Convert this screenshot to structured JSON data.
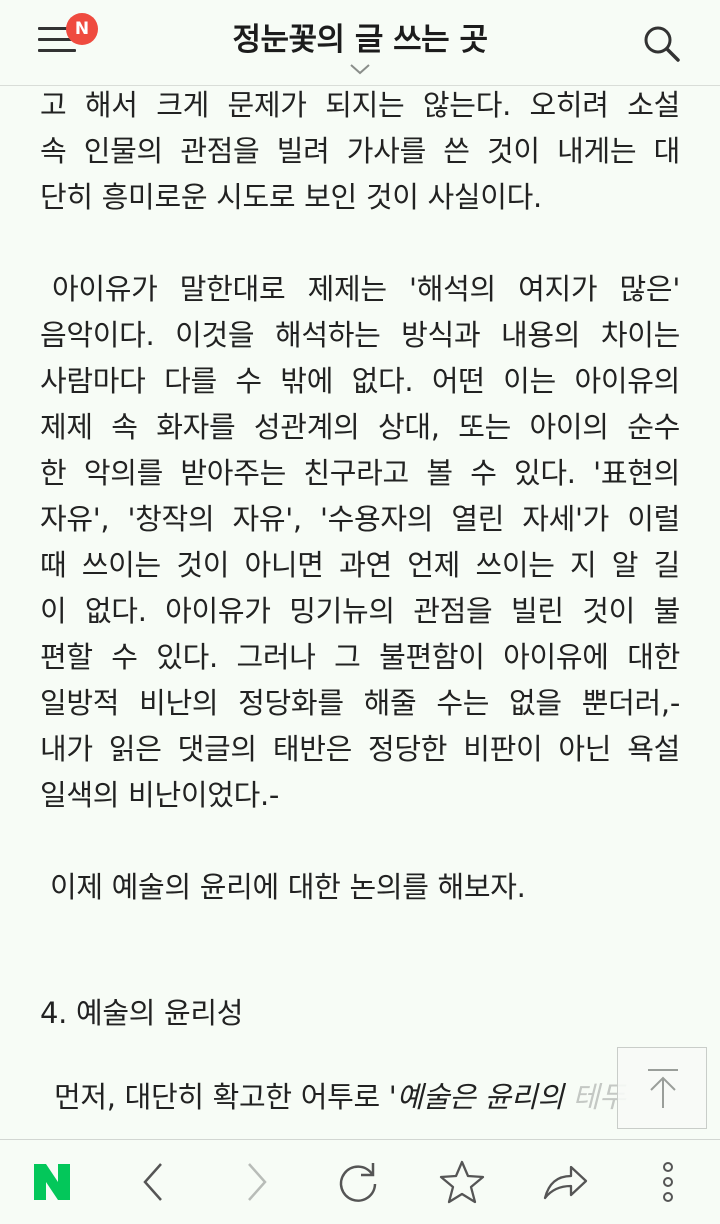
{
  "header": {
    "title": "정눈꽃의 글 쓰는 곳",
    "notification_badge": "N",
    "menu_icon": "hamburger-menu-icon",
    "search_icon": "search-icon",
    "badge_color": "#ef4b3f"
  },
  "article": {
    "lines": [
      "고 해서 크게 문제가 되지는 않는다. 오히려 소설",
      "속 인물의 관점을 빌려 가사를 쓴 것이 내게는 대",
      "단히 흥미로운 시도로 보인 것이 사실이다.",
      "아이유가 말한대로 제제는 '해석의 여지가 많은'",
      "음악이다. 이것을 해석하는 방식과 내용의 차이는",
      "사람마다 다를 수 밖에 없다. 어떤 이는 아이유의",
      "제제 속 화자를 성관계의 상대, 또는 아이의 순수",
      "한 악의를 받아주는 친구라고 볼 수 있다. '표현의",
      "자유', '창작의 자유', '수용자의 열린 자세'가 이럴",
      "때 쓰이는 것이 아니면 과연 언제 쓰이는 지 알 길",
      "이 없다. 아이유가 밍기뉴의 관점을 빌린 것이 불",
      "편할 수 있다. 그러나 그 불편함이 아이유에 대한",
      "일방적 비난의 정당화를 해줄 수는 없을 뿐더러,-",
      "내가 읽은 댓글의 태반은 정당한 비판이 아닌 욕설",
      "일색의 비난이었다.-",
      "이제 예술의 윤리에 대한 논의를 해보자.",
      "4. 예술의 윤리성"
    ],
    "last_line": {
      "plain": "먼저, 대단히 확고한 어투로 ",
      "italic": "'예술은 윤리의 ",
      "faded": "테두"
    }
  },
  "scroll_top_icon": "arrow-up-to-top-icon",
  "toolbar": {
    "items": [
      {
        "icon": "naver-n-logo-icon",
        "label": "N",
        "color": "#03c75a"
      },
      {
        "icon": "back-chevron-icon"
      },
      {
        "icon": "forward-chevron-icon"
      },
      {
        "icon": "refresh-icon"
      },
      {
        "icon": "star-bookmark-icon"
      },
      {
        "icon": "share-arrow-icon"
      },
      {
        "icon": "more-vertical-icon"
      }
    ]
  }
}
